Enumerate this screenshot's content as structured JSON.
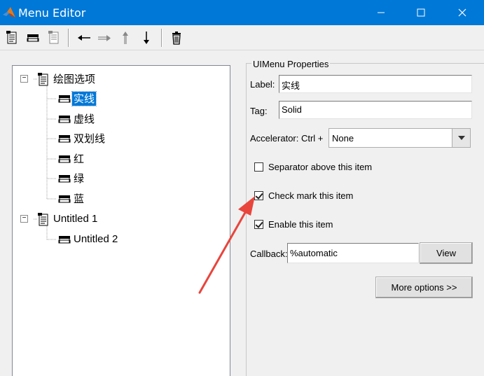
{
  "window": {
    "title": "Menu Editor"
  },
  "toolbar": {
    "buttons": [
      {
        "name": "new-menu-icon"
      },
      {
        "name": "new-menu-item-icon"
      },
      {
        "name": "new-context-menu-icon"
      },
      {
        "name": "move-left-icon"
      },
      {
        "name": "move-right-icon"
      },
      {
        "name": "move-up-icon"
      },
      {
        "name": "move-down-icon"
      },
      {
        "name": "delete-icon"
      }
    ]
  },
  "tree": {
    "items": [
      {
        "label": "绘图选项",
        "level": 0,
        "type": "menu",
        "expanded": true
      },
      {
        "label": "实线",
        "level": 1,
        "type": "item",
        "selected": true
      },
      {
        "label": "虚线",
        "level": 1,
        "type": "item"
      },
      {
        "label": "双划线",
        "level": 1,
        "type": "item"
      },
      {
        "label": "红",
        "level": 1,
        "type": "item"
      },
      {
        "label": "绿",
        "level": 1,
        "type": "item"
      },
      {
        "label": "蓝",
        "level": 1,
        "type": "item"
      },
      {
        "label": "Untitled 1",
        "level": 0,
        "type": "menu",
        "expanded": true
      },
      {
        "label": "Untitled 2",
        "level": 1,
        "type": "item"
      }
    ]
  },
  "properties": {
    "group_title": "UIMenu Properties",
    "label_caption": "Label:",
    "label_value": "实线",
    "tag_caption": "Tag:",
    "tag_value": "Solid",
    "accelerator_caption": "Accelerator: Ctrl +",
    "accelerator_value": "None",
    "separator_label": "Separator above this item",
    "separator_checked": false,
    "checkmark_label": "Check mark this item",
    "checkmark_checked": true,
    "enable_label": "Enable this item",
    "enable_checked": true,
    "callback_caption": "Callback:",
    "callback_value": "%automatic",
    "view_button": "View",
    "more_options_button": "More options >>"
  },
  "colors": {
    "titlebar": "#0078d7",
    "selection": "#0078d7",
    "annotation_arrow": "#e8453c"
  }
}
